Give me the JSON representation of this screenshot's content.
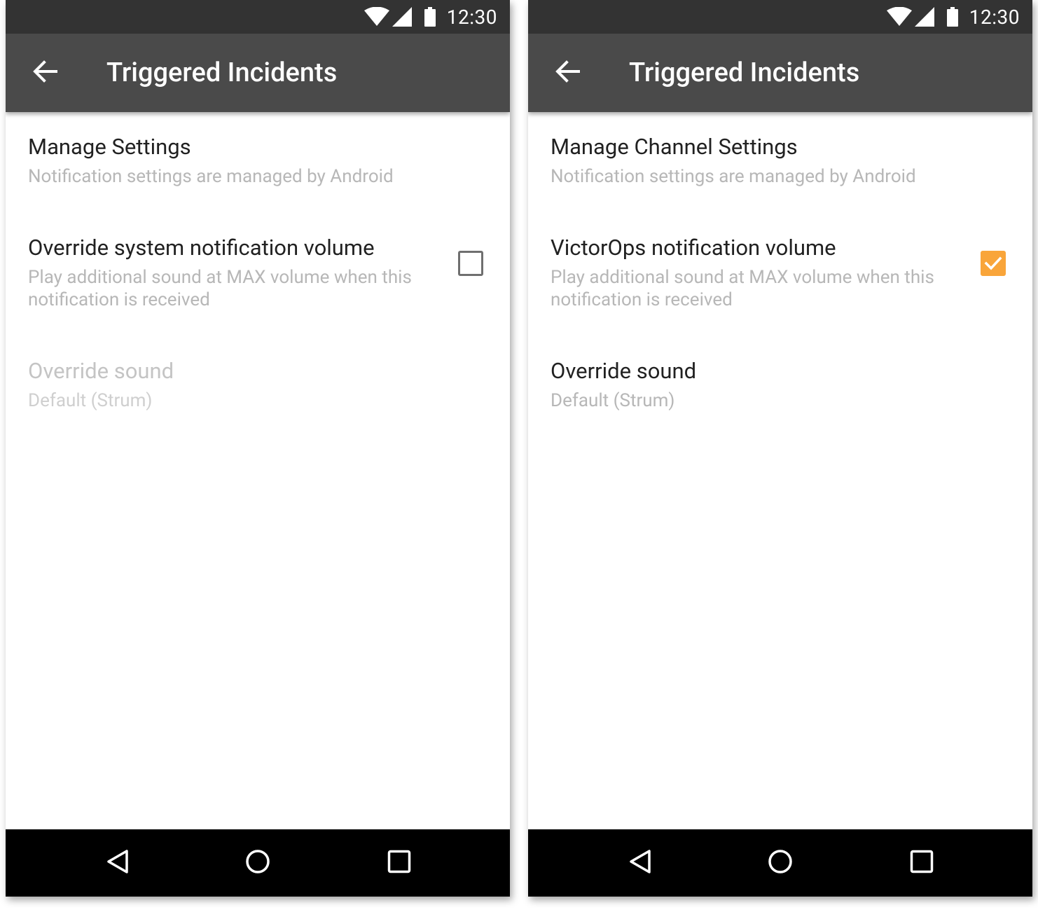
{
  "left": {
    "status_bar": {
      "time": "12:30",
      "icons": [
        "wifi-icon",
        "cell-signal-icon",
        "battery-icon"
      ]
    },
    "app_bar": {
      "title": "Triggered Incidents",
      "back_icon": "arrow-back-icon"
    },
    "manage": {
      "title": "Manage Settings",
      "summary": "Notification settings are managed by Android"
    },
    "volume": {
      "title": "Override system notification volume",
      "summary": "Play additional sound at MAX volume when this notification is received",
      "checked": false
    },
    "sound": {
      "title": "Override sound",
      "summary": "Default (Strum)",
      "enabled": false
    },
    "nav_bar": [
      "nav-back-icon",
      "nav-home-icon",
      "nav-recents-icon"
    ]
  },
  "right": {
    "status_bar": {
      "time": "12:30",
      "icons": [
        "wifi-icon",
        "cell-signal-icon",
        "battery-icon"
      ]
    },
    "app_bar": {
      "title": "Triggered Incidents",
      "back_icon": "arrow-back-icon"
    },
    "manage": {
      "title": "Manage Channel Settings",
      "summary": "Notification settings are managed by Android"
    },
    "volume": {
      "title": "VictorOps notification volume",
      "summary": "Play additional sound at MAX volume when this notification is received",
      "checked": true
    },
    "sound": {
      "title": "Override sound",
      "summary": "Default (Strum)",
      "enabled": true
    },
    "nav_bar": [
      "nav-back-icon",
      "nav-home-icon",
      "nav-recents-icon"
    ]
  },
  "colors": {
    "status_bar": "#333333",
    "app_bar": "#4a4a4a",
    "nav_bar": "#000000",
    "accent": "#f9a53a",
    "primary_text": "#212121",
    "secondary_text": "#b7b7b7"
  }
}
